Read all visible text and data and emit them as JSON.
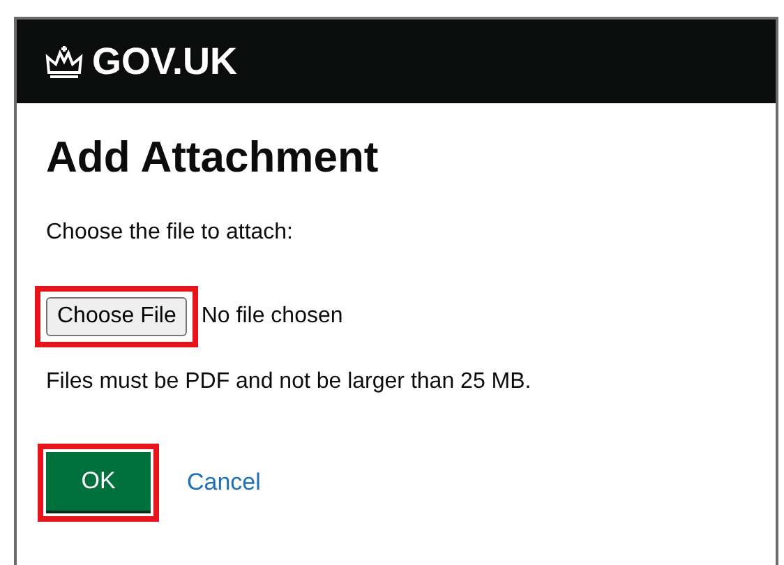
{
  "header": {
    "logo_text": "GOV.UK"
  },
  "dialog": {
    "title": "Add Attachment",
    "prompt": "Choose the file to attach:",
    "file_input": {
      "button_label": "Choose File",
      "status": "No file chosen",
      "highlighted": true
    },
    "hint": "Files must be PDF and not be larger than 25 MB.",
    "buttons": [
      {
        "kind": "primary",
        "label": "OK",
        "highlighted": true
      },
      {
        "kind": "link",
        "label": "Cancel",
        "highlighted": false
      }
    ]
  }
}
